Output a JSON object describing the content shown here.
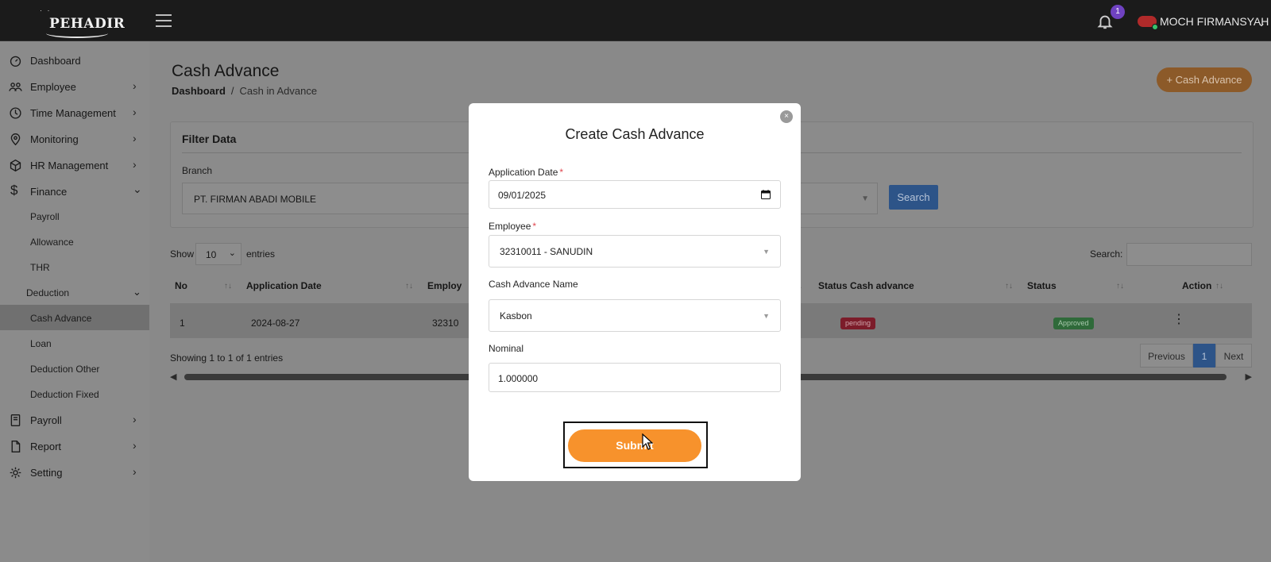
{
  "topbar": {
    "logo_text": "PEHADIR",
    "notification_count": "1",
    "user_name": "MOCH FIRMANSYAH"
  },
  "sidebar": {
    "items": [
      {
        "label": "Dashboard",
        "icon": "gauge-icon"
      },
      {
        "label": "Employee",
        "icon": "users-icon"
      },
      {
        "label": "Time Management",
        "icon": "clock-icon"
      },
      {
        "label": "Monitoring",
        "icon": "map-pin-icon"
      },
      {
        "label": "HR Management",
        "icon": "box-icon"
      },
      {
        "label": "Finance",
        "icon": "dollar-icon"
      }
    ],
    "finance_sub": [
      "Payroll",
      "Allowance",
      "THR"
    ],
    "deduction_label": "Deduction",
    "deduction_sub": [
      "Cash Advance",
      "Loan",
      "Deduction Other",
      "Deduction Fixed"
    ],
    "bottom_items": [
      {
        "label": "Payroll",
        "icon": "book-icon"
      },
      {
        "label": "Report",
        "icon": "file-icon"
      },
      {
        "label": "Setting",
        "icon": "gear-icon"
      }
    ]
  },
  "page": {
    "title": "Cash Advance",
    "breadcrumb_home": "Dashboard",
    "breadcrumb_current": "Cash in Advance",
    "add_button": "+ Cash Advance"
  },
  "filter": {
    "title": "Filter Data",
    "branch_label": "Branch",
    "branch_value": "PT. FIRMAN ABADI MOBILE",
    "search_button": "Search"
  },
  "table": {
    "show_label": "Show",
    "show_value": "10",
    "entries_label": "entries",
    "search_label": "Search:",
    "columns": [
      "No",
      "Application Date",
      "Employ",
      "Status Cash advance",
      "Status",
      "Action"
    ],
    "rows": [
      {
        "no": "1",
        "application_date": "2024-08-27",
        "employee": "32310",
        "status_cash_advance": "pending",
        "status": "Approved"
      }
    ],
    "showing_text": "Showing 1 to 1 of 1 entries",
    "pager": {
      "previous": "Previous",
      "current": "1",
      "next": "Next"
    }
  },
  "modal": {
    "title": "Create Cash Advance",
    "close_symbol": "×",
    "application_date_label": "Application Date",
    "application_date_value": "09/01/2025",
    "employee_label": "Employee",
    "employee_value": "32310011 - SANUDIN",
    "cash_advance_name_label": "Cash Advance Name",
    "cash_advance_name_value": "Kasbon",
    "nominal_label": "Nominal",
    "nominal_value": "1.000000",
    "required_mark": "*",
    "submit_label": "Submit"
  },
  "colors": {
    "accent_orange": "#f7922c",
    "primary_blue": "#2d5488",
    "pending_red": "#dc3545",
    "approved_green": "#4caf50"
  }
}
